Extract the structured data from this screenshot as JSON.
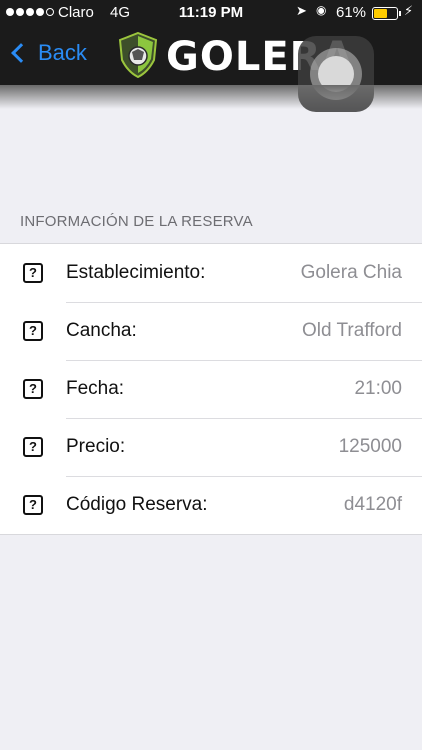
{
  "status_bar": {
    "carrier": "Claro",
    "network": "4G",
    "time": "11:19 PM",
    "battery": "61%",
    "battery_level": 0.61,
    "signal_bars_filled": 4,
    "signal_bars_total": 5
  },
  "nav": {
    "back_label": "Back",
    "brand": "GOLERA"
  },
  "section": {
    "header": "INFORMACIÓN DE LA RESERVA",
    "rows": [
      {
        "label": "Establecimiento:",
        "value": "Golera Chia",
        "icon": "question-icon"
      },
      {
        "label": "Cancha:",
        "value": "Old Trafford",
        "icon": "question-icon"
      },
      {
        "label": "Fecha:",
        "value": "21:00",
        "icon": "question-icon"
      },
      {
        "label": "Precio:",
        "value": "125000",
        "icon": "question-icon"
      },
      {
        "label": "Código Reserva:",
        "value": "d4120f",
        "icon": "question-icon"
      }
    ]
  },
  "colors": {
    "nav_background": "#1b1b1b",
    "accent": "#2a8cf5",
    "page_background": "#efeff4",
    "battery_fill": "#ffcc00"
  }
}
